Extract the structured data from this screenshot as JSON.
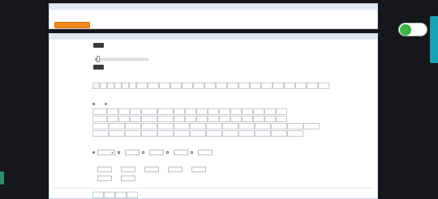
{
  "header_panel": {
    "title": "",
    "more_link": "",
    "notice": "",
    "select_button": ""
  },
  "filter_panel": {
    "title": "",
    "more_link": "",
    "level": {
      "label": "",
      "tooltip_top": "",
      "tooltip_bottom": "",
      "slider_value": 0
    },
    "type": {
      "label": "",
      "row1": [
        "",
        "",
        "",
        "",
        "",
        "",
        "",
        "",
        "",
        "",
        "",
        "",
        "",
        "",
        "",
        "",
        "",
        "",
        "",
        "",
        "",
        "",
        ""
      ]
    },
    "attr": {
      "label": "",
      "option_a": "",
      "option_b": "",
      "row1": [
        "",
        "",
        "",
        "",
        "",
        "",
        "",
        "",
        "",
        "",
        "",
        "",
        "",
        "",
        "",
        ""
      ],
      "row2": [
        "",
        "",
        "",
        "",
        "",
        "",
        "",
        "",
        "",
        "",
        "",
        "",
        "",
        "",
        "",
        ""
      ],
      "row3": [
        "",
        "",
        "",
        "",
        "",
        "",
        "",
        "",
        "",
        "",
        "",
        "",
        "",
        ""
      ],
      "row4": [
        "",
        "",
        "",
        "",
        "",
        "",
        "",
        "",
        "",
        "",
        "",
        "",
        ""
      ],
      "more_link": ""
    },
    "condition": {
      "label": "",
      "select_value": "",
      "option1": "",
      "option2": "",
      "option3": "",
      "option4": ""
    },
    "stats": {
      "label": "",
      "fields_row1": [
        "",
        "",
        "",
        "",
        ""
      ],
      "fields_row2": [
        "",
        ""
      ]
    },
    "bottom_label": ""
  },
  "floating": {
    "badge_label": "",
    "badge_line1": "",
    "badge_line2": "",
    "right_tab_label": ""
  },
  "colors": {
    "accent_orange": "#f08a1c",
    "bar_bg": "#dfe8f3",
    "teal_tab": "#16a3b5",
    "green_badge": "#3bb24a"
  }
}
